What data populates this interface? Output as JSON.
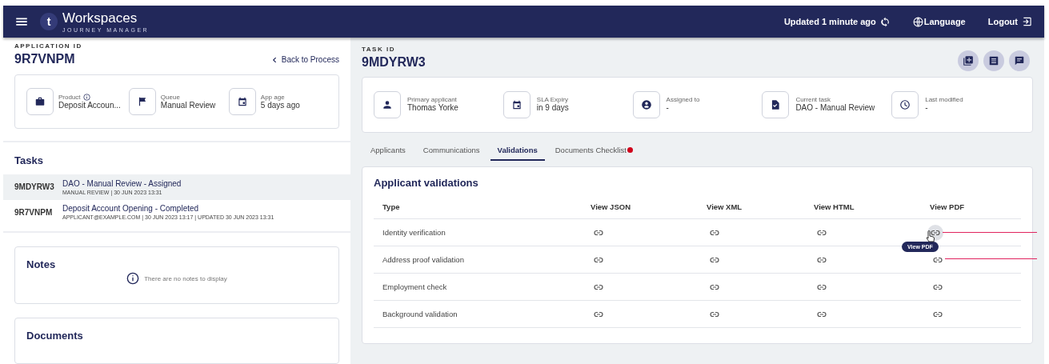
{
  "header": {
    "brand_letter": "t",
    "title": "Workspaces",
    "subtitle": "JOURNEY MANAGER",
    "updated": "Updated 1 minute ago",
    "language": "Language",
    "logout": "Logout"
  },
  "application": {
    "label": "APPLICATION ID",
    "id": "9R7VNPM",
    "back": "Back to Process",
    "info": [
      {
        "kind": "product",
        "label": "Product",
        "value": "Deposit Accoun...",
        "info_icon": true
      },
      {
        "kind": "queue",
        "label": "Queue",
        "value": "Manual Review",
        "info_icon": false
      },
      {
        "kind": "age",
        "label": "App age",
        "value": "5 days ago",
        "info_icon": false
      }
    ]
  },
  "tasks": {
    "title": "Tasks",
    "items": [
      {
        "id": "9MDYRW3",
        "title": "DAO - Manual Review - Assigned",
        "meta": "MANUAL REVIEW | 30 JUN 2023 13:31",
        "selected": true
      },
      {
        "id": "9R7VNPM",
        "title": "Deposit Account Opening - Completed",
        "meta": "APPLICANT@EXAMPLE.COM | 30 JUN 2023 13:17 | UPDATED 30 JUN 2023 13:31",
        "selected": false
      }
    ]
  },
  "notes": {
    "title": "Notes",
    "empty": "There are no notes to display"
  },
  "documents": {
    "title": "Documents"
  },
  "task": {
    "label": "TASK ID",
    "id": "9MDYRW3",
    "info": [
      {
        "kind": "person",
        "label": "Primary applicant",
        "value": "Thomas Yorke"
      },
      {
        "kind": "calendar",
        "label": "SLA Expiry",
        "value": "in 9 days"
      },
      {
        "kind": "account",
        "label": "Assigned to",
        "value": "-"
      },
      {
        "kind": "document",
        "label": "Current task",
        "value": "DAO - Manual Review"
      },
      {
        "kind": "clock",
        "label": "Last modified",
        "value": "-"
      }
    ]
  },
  "tabs": [
    {
      "label": "Applicants",
      "selected": false,
      "badge": false
    },
    {
      "label": "Communications",
      "selected": false,
      "badge": false
    },
    {
      "label": "Validations",
      "selected": true,
      "badge": false
    },
    {
      "label": "Documents Checklist",
      "selected": false,
      "badge": true
    }
  ],
  "validations": {
    "title": "Applicant validations",
    "columns": [
      "Type",
      "View JSON",
      "View XML",
      "View HTML",
      "View PDF"
    ],
    "rows": [
      {
        "type": "Identity verification",
        "links": [
          {
            "hovered": false
          },
          {
            "hovered": false
          },
          {
            "hovered": false
          },
          {
            "hovered": true
          }
        ]
      },
      {
        "type": "Address proof validation",
        "links": [
          {
            "hovered": false
          },
          {
            "hovered": false
          },
          {
            "hovered": false
          },
          {
            "hovered": false
          }
        ]
      },
      {
        "type": "Employment check",
        "links": [
          {
            "hovered": false
          },
          {
            "hovered": false
          },
          {
            "hovered": false
          },
          {
            "hovered": false
          }
        ]
      },
      {
        "type": "Background validation",
        "links": [
          {
            "hovered": false
          },
          {
            "hovered": false
          },
          {
            "hovered": false
          },
          {
            "hovered": false
          }
        ]
      }
    ],
    "tooltip": "View PDF"
  }
}
